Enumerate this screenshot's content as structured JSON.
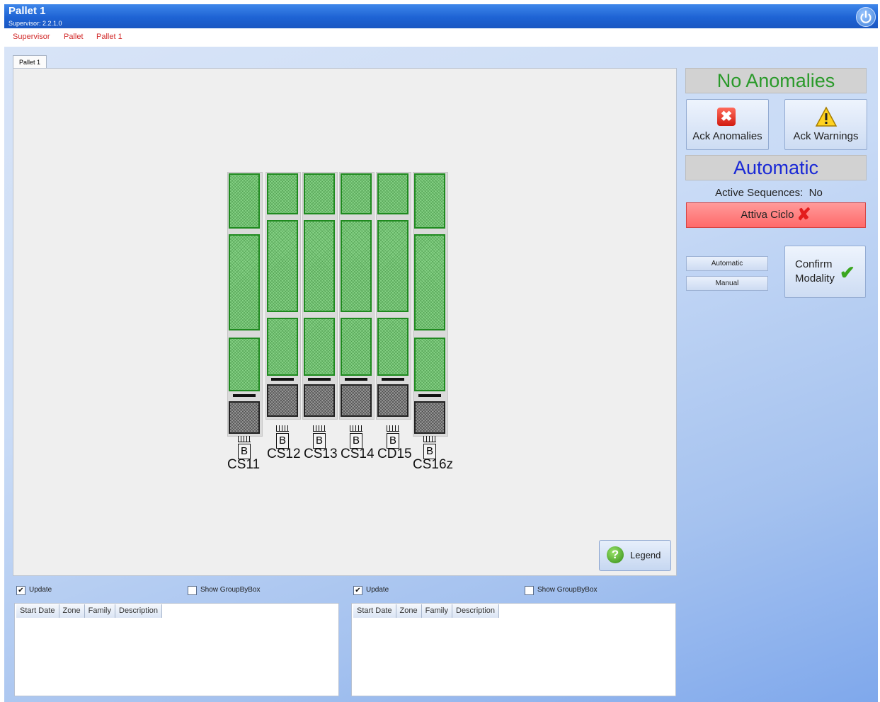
{
  "window": {
    "title": "Pallet 1",
    "subtitle": "Supervisor: 2.2.1.0",
    "power_icon": "power-icon"
  },
  "breadcrumb": [
    "Supervisor",
    "Pallet",
    "Pallet 1"
  ],
  "tab": {
    "label": "Pallet 1"
  },
  "pallet": {
    "columns": [
      "CS11",
      "CS12",
      "CS13",
      "CS14",
      "CD15",
      "CS16z"
    ],
    "badge": "B"
  },
  "legend": {
    "label": "Legend",
    "icon": "help-icon"
  },
  "right_panel": {
    "status": "No Anomalies",
    "ack_anomalies": "Ack Anomalies",
    "ack_warnings": "Ack Warnings",
    "mode": "Automatic",
    "active_sequences": "Active Sequences:  No",
    "attiva_ciclo": "Attiva Ciclo",
    "automatic_btn": "Automatic",
    "manual_btn": "Manual",
    "confirm_line1": "Confirm",
    "confirm_line2": "Modality"
  },
  "bottom": {
    "left": {
      "update": "Update",
      "update_checked": true,
      "group": "Show GroupByBox",
      "group_checked": false,
      "columns": [
        "Start Date",
        "Zone",
        "Family",
        "Description"
      ]
    },
    "right": {
      "update": "Update",
      "update_checked": true,
      "group": "Show GroupByBox",
      "group_checked": false,
      "columns": [
        "Start Date",
        "Zone",
        "Family",
        "Description"
      ]
    }
  },
  "colors": {
    "title_blue": "#1e63d4",
    "status_green": "#2a9a2a",
    "mode_blue": "#1a29d6",
    "attiva_red": "#ff6a6a",
    "cell_green": "#86d286"
  }
}
